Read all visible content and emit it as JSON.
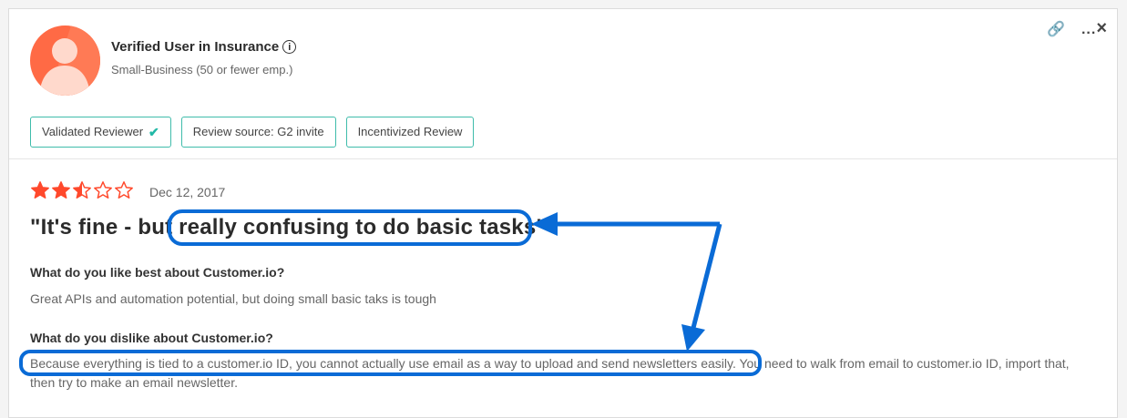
{
  "reviewer": {
    "name": "Verified User in Insurance",
    "info_icon": "info-icon",
    "segment": "Small-Business (50 or fewer emp.)"
  },
  "actions": {
    "link_icon": "link-icon",
    "more_label": "...",
    "close_label": "×"
  },
  "badges": [
    {
      "label": "Validated Reviewer",
      "icon": "checkmark-icon"
    },
    {
      "label": "Review source: G2 invite"
    },
    {
      "label": "Incentivized Review"
    }
  ],
  "review": {
    "rating": 2.5,
    "max_rating": 5,
    "date": "Dec 12, 2017",
    "title": "\"It's fine - but really confusing to do basic tasks\"",
    "questions": [
      {
        "question": "What do you like best about Customer.io?",
        "answer": "Great APIs and automation potential, but doing small basic taks is tough"
      },
      {
        "question": "What do you dislike about Customer.io?",
        "answer": "Because everything is tied to a customer.io ID, you cannot actually use email as a way to upload and send newsletters easily. You need to walk from email to customer.io ID, import that, then try to make an email newsletter."
      }
    ]
  },
  "colors": {
    "star": "#ff492c",
    "badge_border": "#3fbcab",
    "annotation": "#0a6bd6",
    "avatar": "#ff6a45"
  }
}
